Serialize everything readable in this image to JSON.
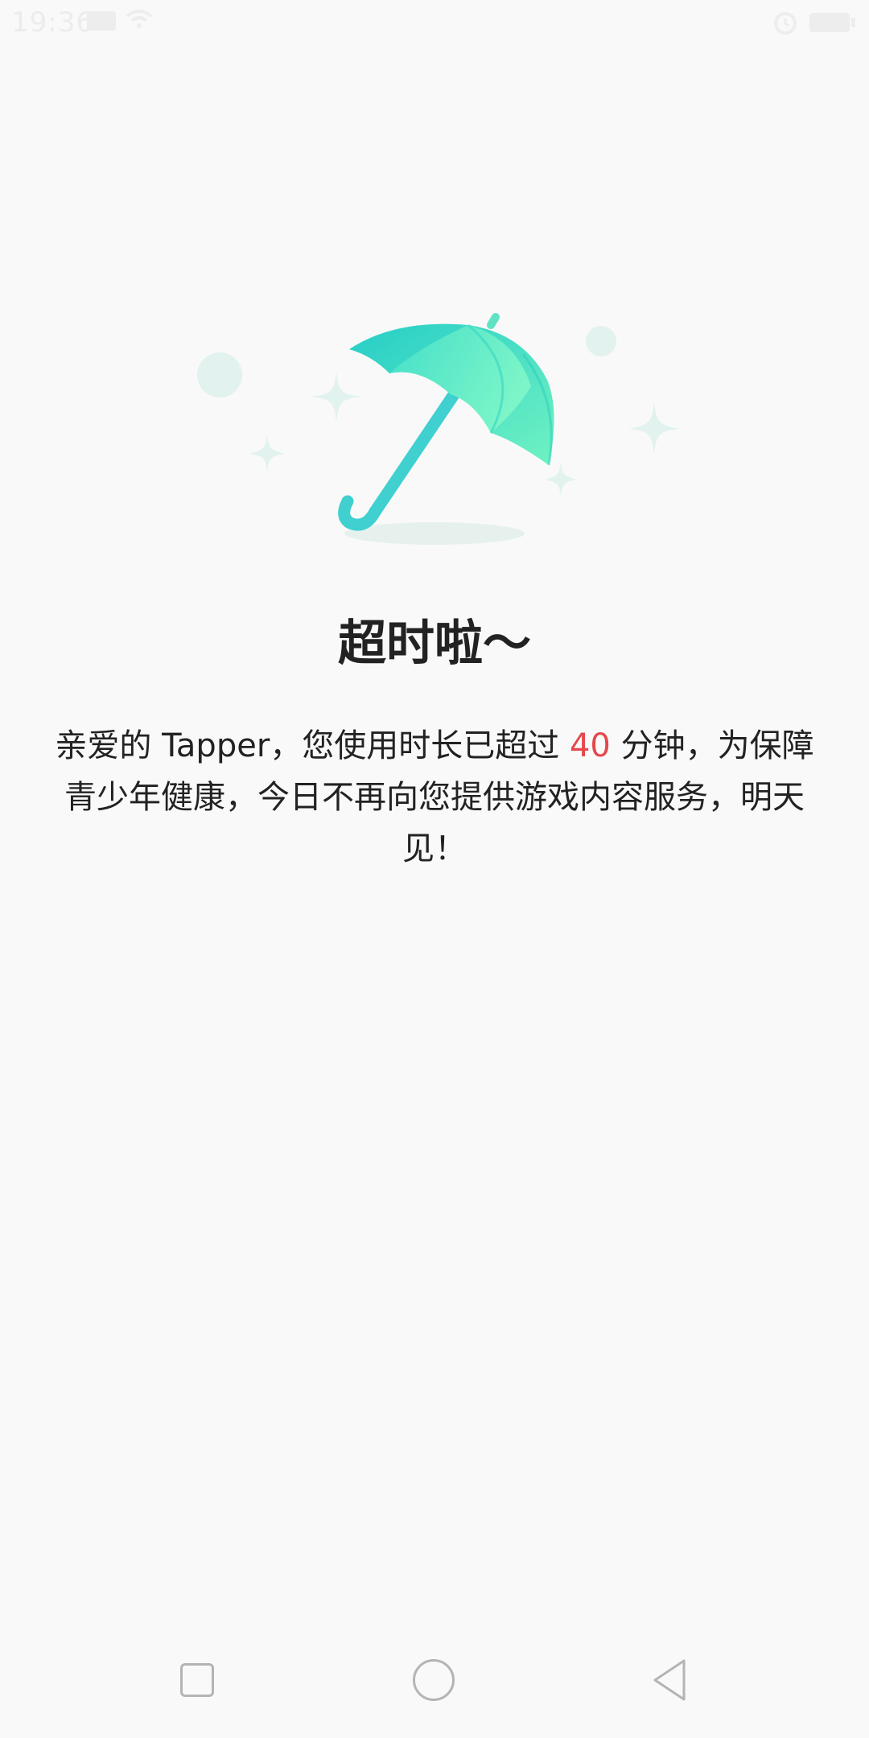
{
  "status_bar": {
    "time": "19:36",
    "icons": [
      "message-icon",
      "wifi-icon",
      "alarm-icon",
      "battery-icon"
    ]
  },
  "illustration": {
    "icon": "umbrella-icon",
    "colors": {
      "umbrella_light": "#6ff2c2",
      "umbrella_dark": "#22cfc6",
      "handle": "#3fd0cf",
      "sparkle": "#e2f2ee",
      "shadow": "#e6f1ee"
    }
  },
  "main": {
    "title": "超时啦～",
    "message": {
      "part1": "亲爱的 Tapper，您使用时长已超过 ",
      "minutes": "40",
      "part2": " 分钟，为保障青少年健康，今日不再向您提供游戏内容服务，明天见！"
    },
    "accent_color": "#e5484d"
  },
  "nav_bar": {
    "buttons": [
      "recent-apps",
      "home",
      "back"
    ]
  }
}
